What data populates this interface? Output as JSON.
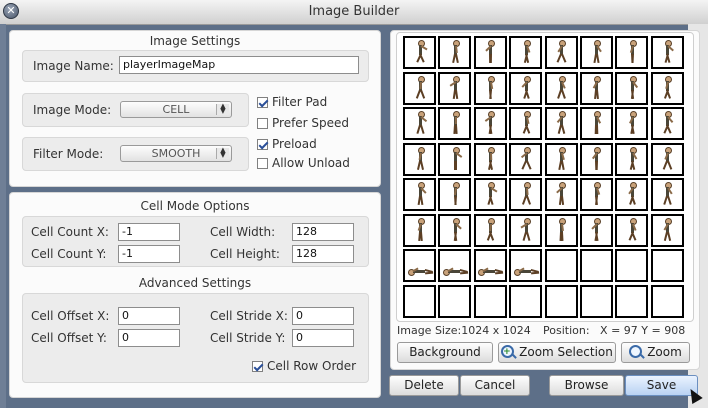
{
  "window": {
    "title": "Image Builder",
    "close_glyph": "✕"
  },
  "image_settings": {
    "title": "Image Settings",
    "image_name_label": "Image Name:",
    "image_name_value": "playerImageMap",
    "image_mode_label": "Image Mode:",
    "image_mode_value": "CELL",
    "filter_mode_label": "Filter Mode:",
    "filter_mode_value": "SMOOTH",
    "checkboxes": [
      {
        "label": "Filter Pad",
        "checked": true
      },
      {
        "label": "Prefer Speed",
        "checked": false
      },
      {
        "label": "Preload",
        "checked": true
      },
      {
        "label": "Allow Unload",
        "checked": false
      }
    ]
  },
  "cell_mode": {
    "title": "Cell Mode Options",
    "count_x_label": "Cell Count X:",
    "count_x_value": "-1",
    "count_y_label": "Cell Count Y:",
    "count_y_value": "-1",
    "width_label": "Cell Width:",
    "width_value": "128",
    "height_label": "Cell Height:",
    "height_value": "128"
  },
  "advanced": {
    "title": "Advanced Settings",
    "offset_x_label": "Cell Offset X:",
    "offset_x_value": "0",
    "offset_y_label": "Cell Offset Y:",
    "offset_y_value": "0",
    "stride_x_label": "Cell Stride X:",
    "stride_x_value": "0",
    "stride_y_label": "Cell Stride Y:",
    "stride_y_value": "0",
    "row_order_label": "Cell Row Order",
    "row_order_checked": true
  },
  "preview": {
    "image_size_label": "Image Size:",
    "image_size_value": "1024 x 1024",
    "position_label": "Position:",
    "position_value": "X = 97 Y = 908",
    "columns": 8,
    "rows": 8,
    "filled_cells": 52,
    "lying_cells": [
      48,
      49,
      50,
      51
    ],
    "background_button": "Background",
    "zoom_selection_button": "Zoom Selection",
    "zoom_button": "Zoom",
    "icons": {
      "zoom_selection": "zoom-plus-icon",
      "zoom": "magnifier-icon"
    }
  },
  "footer": {
    "delete_button": "Delete",
    "cancel_button": "Cancel",
    "browse_button": "Browse",
    "save_button": "Save"
  }
}
